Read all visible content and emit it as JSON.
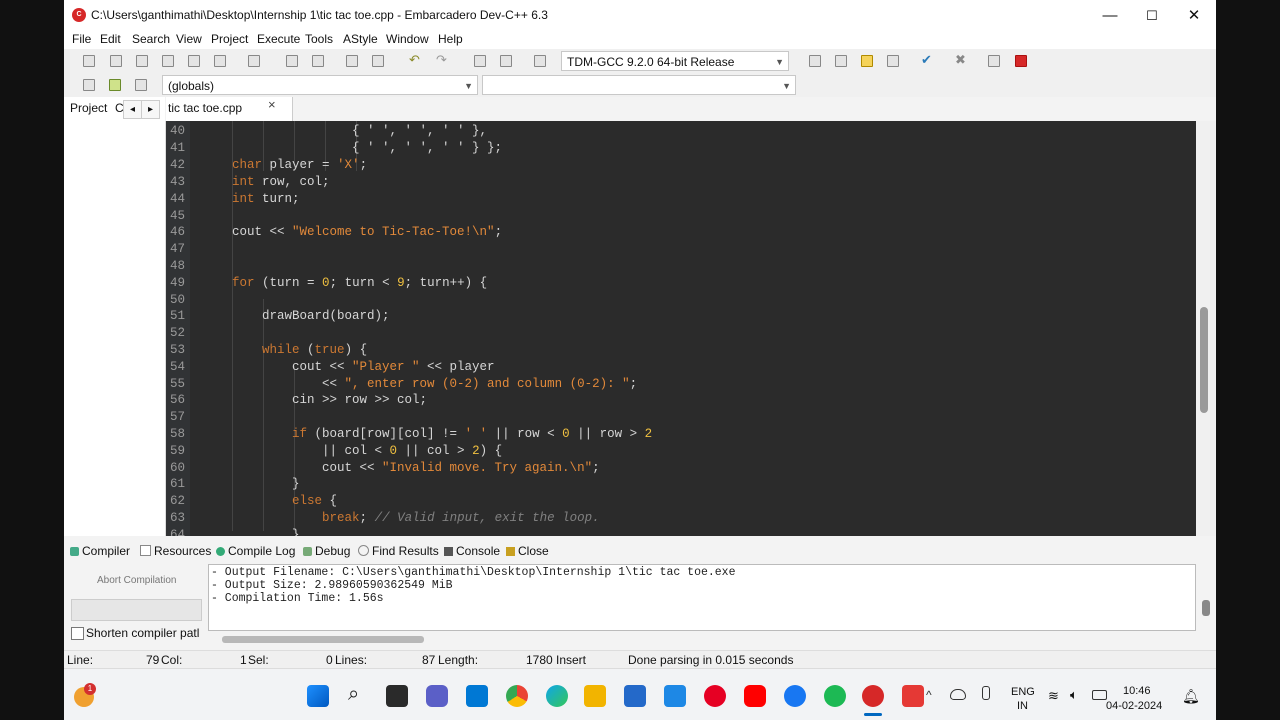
{
  "window": {
    "title": "C:\\Users\\ganthimathi\\Desktop\\Internship 1\\tic tac toe.cpp - Embarcadero Dev-C++ 6.3",
    "minimize": "—",
    "maximize": "☐",
    "close": "✕"
  },
  "menu": [
    "File",
    "Edit",
    "Search",
    "View",
    "Project",
    "Execute",
    "Tools",
    "AStyle",
    "Window",
    "Help"
  ],
  "toolbar": {
    "compiler_select": "TDM-GCC 9.2.0 64-bit Release",
    "scope_select": "(globals)",
    "function_select": ""
  },
  "tabs": {
    "project": "Project",
    "classes": "C",
    "prev": "◂",
    "next": "▸",
    "file": "tic tac toe.cpp",
    "file_close": "×"
  },
  "editor": {
    "line_numbers": [
      "40",
      "41",
      "42",
      "43",
      "44",
      "45",
      "46",
      "47",
      "48",
      "49",
      "50",
      "51",
      "52",
      "53",
      "54",
      "55",
      "56",
      "57",
      "58",
      "59",
      "60",
      "61",
      "62",
      "63",
      "64"
    ]
  },
  "bottom_tabs": {
    "compiler": "Compiler",
    "resources": "Resources",
    "compile_log": "Compile Log",
    "debug": "Debug",
    "find_results": "Find Results",
    "console": "Console",
    "close": "Close"
  },
  "compile_panel": {
    "abort_label": "Abort Compilation",
    "shorten_label": "Shorten compiler patl",
    "log": [
      "- Output Filename: C:\\Users\\ganthimathi\\Desktop\\Internship 1\\tic tac toe.exe",
      "- Output Size: 2.98960590362549 MiB",
      "- Compilation Time: 1.56s"
    ]
  },
  "status": {
    "line_label": "Line:",
    "line_value": "79",
    "col_label": "Col:",
    "col_value": "1",
    "sel_label": "Sel:",
    "sel_value": "0",
    "lines_label": "Lines:",
    "lines_value": "87",
    "length_label": "Length:",
    "length_value": "1780",
    "mode": "Insert",
    "message": "Done parsing in 0.015 seconds"
  },
  "taskbar": {
    "notification_badge": "1",
    "lang_top": "ENG",
    "lang_bottom": "IN",
    "time": "10:46",
    "date": "04-02-2024",
    "accent_colors": [
      "#0078d4",
      "#f2b400",
      "#1e88e5",
      "#e53935",
      "#1db954",
      "#d62828"
    ]
  }
}
